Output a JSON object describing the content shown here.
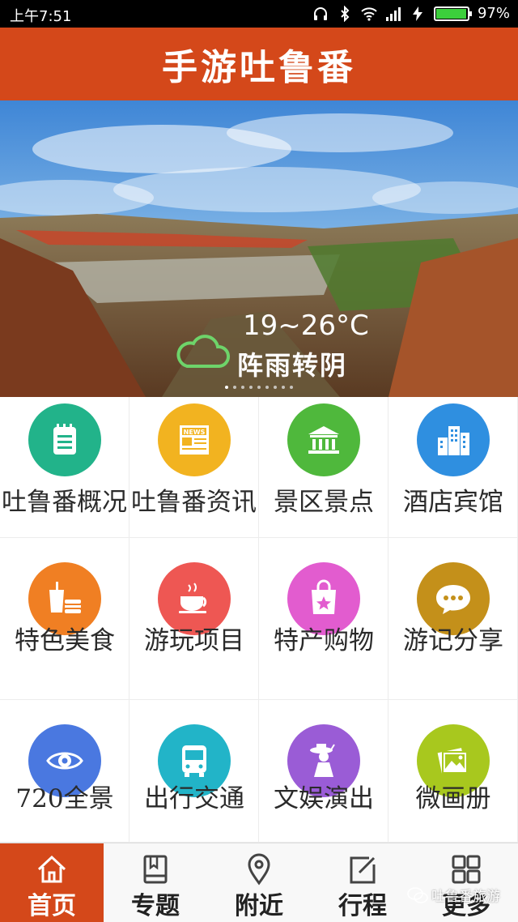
{
  "status_bar": {
    "time": "上午7:51",
    "battery_percent": "97%",
    "battery_level": 0.97
  },
  "header": {
    "title": "手游吐鲁番"
  },
  "banner": {
    "temperature": "19~26°C",
    "condition": "阵雨转阴",
    "carousel_count": 9,
    "carousel_active": 0,
    "cloud_icon": "cloud-icon"
  },
  "grid": [
    {
      "label": "吐鲁番概况",
      "color": "#22b38a",
      "icon": "notepad-icon"
    },
    {
      "label": "吐鲁番资讯",
      "color": "#f2b320",
      "icon": "newspaper-icon"
    },
    {
      "label": "景区景点",
      "color": "#4fb83c",
      "icon": "landmark-icon"
    },
    {
      "label": "酒店宾馆",
      "color": "#2f8fe0",
      "icon": "buildings-icon"
    },
    {
      "label": "特色美食",
      "color": "#f07f23",
      "icon": "food-icon"
    },
    {
      "label": "游玩项目",
      "color": "#ee5753",
      "icon": "teacup-icon"
    },
    {
      "label": "特产购物",
      "color": "#e25ccf",
      "icon": "shopping-bag-icon"
    },
    {
      "label": "游记分享",
      "color": "#c4901a",
      "icon": "chat-bubble-icon"
    },
    {
      "label": "720全景",
      "color": "#4a78e0",
      "icon": "eye-icon"
    },
    {
      "label": "出行交通",
      "color": "#22b4c8",
      "icon": "bus-icon"
    },
    {
      "label": "文娱演出",
      "color": "#9a5cd6",
      "icon": "performer-icon"
    },
    {
      "label": "微画册",
      "color": "#a8c81e",
      "icon": "photo-album-icon"
    }
  ],
  "bottom_nav": [
    {
      "label": "首页",
      "icon": "home-icon"
    },
    {
      "label": "专题",
      "icon": "book-icon"
    },
    {
      "label": "附近",
      "icon": "location-pin-icon"
    },
    {
      "label": "行程",
      "icon": "edit-icon"
    },
    {
      "label": "更多",
      "icon": "grid-icon"
    }
  ],
  "watermark": {
    "text": "吐鲁番旅游"
  },
  "colors": {
    "header": "#d4481a",
    "nav_active": "#d4481a"
  }
}
